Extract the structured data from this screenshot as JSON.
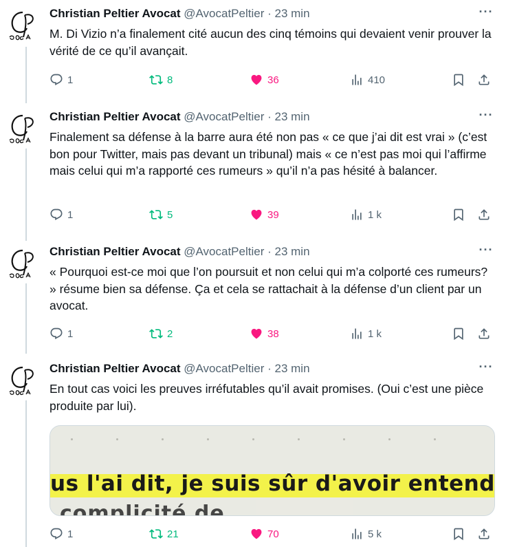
{
  "author": {
    "name": "Christian Peltier Avocat",
    "handle": "@AvocatPeltier",
    "separator": "·"
  },
  "more_label": "···",
  "tweets": [
    {
      "time": "23 min",
      "text": "M. Di Vizio n’a finalement cité aucun des cinq témoins qui devaient venir prouver la vérité de ce qu’il avançait.",
      "replies": "1",
      "retweets": "8",
      "likes": "36",
      "views": "410"
    },
    {
      "time": "23 min",
      "text": "Finalement sa défense à la barre aura été non pas « ce que j’ai dit est vrai » (c’est bon pour Twitter, mais pas devant un tribunal) mais « ce n’est pas moi qui l’affirme mais celui qui m’a rapporté ces rumeurs » qu’il n’a pas hésité à balancer.",
      "replies": "1",
      "retweets": "5",
      "likes": "39",
      "views": "1 k"
    },
    {
      "time": "23 min",
      "text": "« Pourquoi est-ce moi que l’on poursuit et non celui qui m’a colporté ces rumeurs? » résume bien sa défense. Ça et cela se rattachait à la défense d’un client par un avocat.",
      "replies": "1",
      "retweets": "2",
      "likes": "38",
      "views": "1 k"
    },
    {
      "time": "23 min",
      "text": "En tout cas voici les preuves irréfutables qu’il avait promises. (Oui c’est une pièce produite par lui).",
      "replies": "1",
      "retweets": "21",
      "likes": "70",
      "views": "5 k",
      "media": {
        "line1": "us l'ai dit, je suis sûr d'avoir entendu",
        "line2": "complicité de"
      }
    }
  ],
  "colors": {
    "retweet": "#00ba7c",
    "like": "#f91880",
    "muted": "#536471",
    "highlight": "#f3f24a"
  },
  "icons": [
    "reply-icon",
    "retweet-icon",
    "like-icon",
    "views-icon",
    "bookmark-icon",
    "share-icon"
  ]
}
